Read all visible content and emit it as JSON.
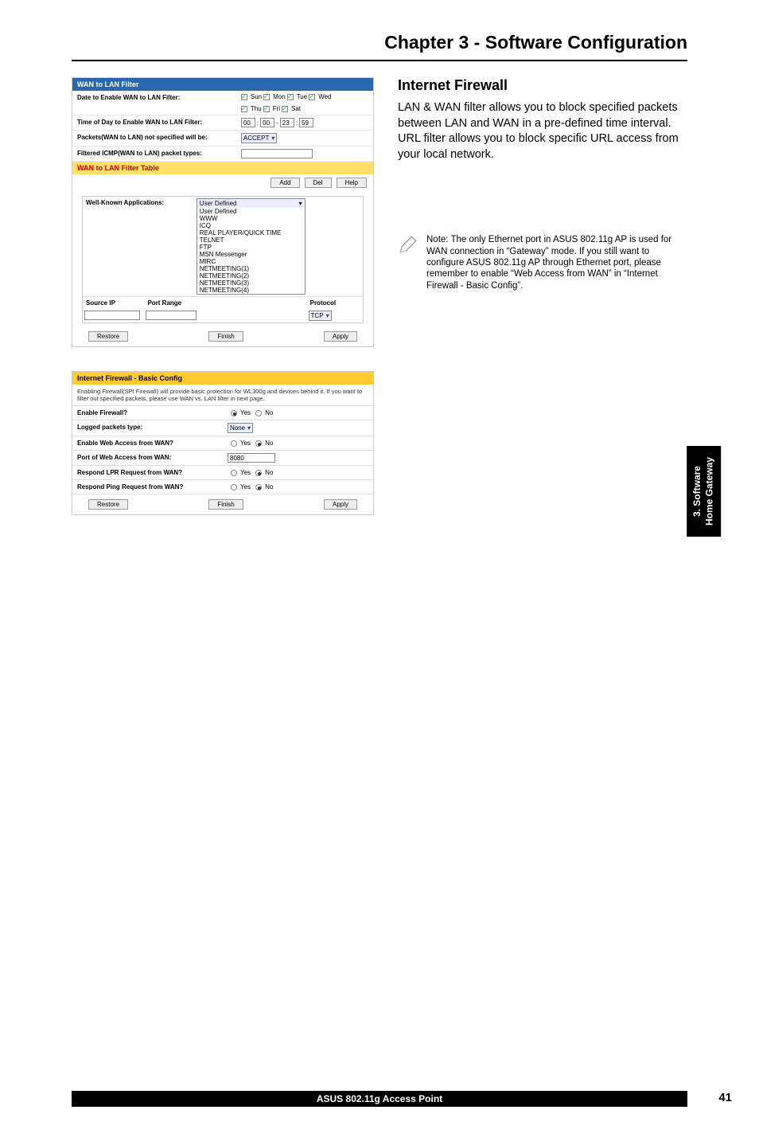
{
  "chapter_title": "Chapter 3 - Software Configuration",
  "shot1": {
    "title": "WAN to LAN Filter",
    "r1_label": "Date to Enable WAN to LAN Filter:",
    "days": [
      "Sun",
      "Mon",
      "Tue",
      "Wed",
      "Thu",
      "Fri",
      "Sat"
    ],
    "r2_label": "Time of Day to Enable WAN to LAN Filter:",
    "t1": "00",
    "t2": "00",
    "t3": "23",
    "t4": "59",
    "r3_label": "Packets(WAN to LAN) not specified will be:",
    "r3_sel": "ACCEPT",
    "r4_label": "Filtered ICMP(WAN to LAN) packet types:",
    "table_title": "WAN to LAN Filter Table",
    "btn_add": "Add",
    "btn_del": "Del",
    "btn_help": "Help",
    "wk_label": "Well-Known Applications:",
    "wk_sel": "User Defined",
    "col_src": "Source IP",
    "col_port": "Port Range",
    "col_proto": "Protocol",
    "proto_sel": "TCP",
    "drop_items": [
      "User Defined",
      "WWW",
      "ICQ",
      "REAL PLAYER/QUICK TIME",
      "TELNET",
      "FTP",
      "MSN Messenger",
      "MIRC",
      "NETMEETING(1)",
      "NETMEETING(2)",
      "NETMEETING(3)",
      "NETMEETING(4)"
    ],
    "btn_restore": "Restore",
    "btn_finish": "Finish",
    "btn_apply": "Apply"
  },
  "shot2": {
    "title": "Internet Firewall - Basic Config",
    "desc": "Enabling Firewall(SPI Firewall) will provide basic protection for WL300g and devices behind it. If you want to filter out specified packets, please use WAN vs. LAN filter in next page.",
    "rows": [
      {
        "label": "Enable Firewall?",
        "type": "yn",
        "yes": true
      },
      {
        "label": "Logged packets type:",
        "type": "sel",
        "val": "None"
      },
      {
        "label": "Enable Web Access from WAN?",
        "type": "yn",
        "yes": false
      },
      {
        "label": "Port of Web Access from WAN:",
        "type": "txt",
        "val": "8080"
      },
      {
        "label": "Respond LPR Request from WAN?",
        "type": "yn",
        "yes": false
      },
      {
        "label": "Respond Ping Request from WAN?",
        "type": "yn",
        "yes": false
      }
    ],
    "yes_lbl": "Yes",
    "no_lbl": "No",
    "btn_restore": "Restore",
    "btn_finish": "Finish",
    "btn_apply": "Apply"
  },
  "right": {
    "heading": "Internet Firewall",
    "para": "LAN & WAN filter allows you to block specified packets between LAN and WAN in a pre-defined time interval. URL filter allows you to block specific URL access from your local network.",
    "note": "Note: The only Ethernet port in ASUS 802.11g AP is used for WAN connection in “Gateway” mode. If you still want to configure ASUS 802.11g AP through Ethernet port, please remember to enable “Web Access from WAN” in “Internet Firewall - Basic Config”."
  },
  "sidetab": {
    "l1": "3. Software",
    "l2": "Home Gateway"
  },
  "footer": {
    "title": "ASUS 802.11g Access Point",
    "page": "41"
  }
}
